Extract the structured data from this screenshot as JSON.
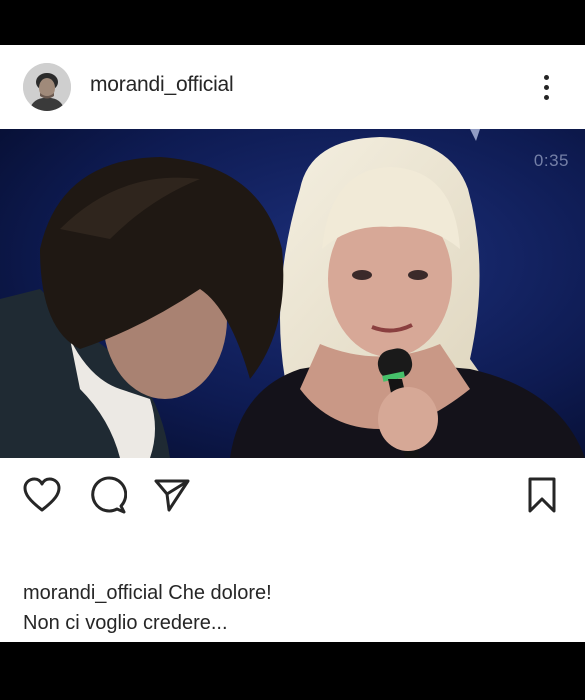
{
  "post": {
    "username": "morandi_official",
    "video_time": "0:35",
    "caption_user": "morandi_official",
    "caption_line1": "Che dolore!",
    "caption_line2": "Non ci voglio credere..."
  },
  "icons": {
    "more": "more-vertical-icon",
    "like": "heart-icon",
    "comment": "comment-icon",
    "share": "send-icon",
    "save": "bookmark-icon"
  },
  "colors": {
    "text": "#262626",
    "background": "#ffffff",
    "stage": "#0a1540"
  }
}
